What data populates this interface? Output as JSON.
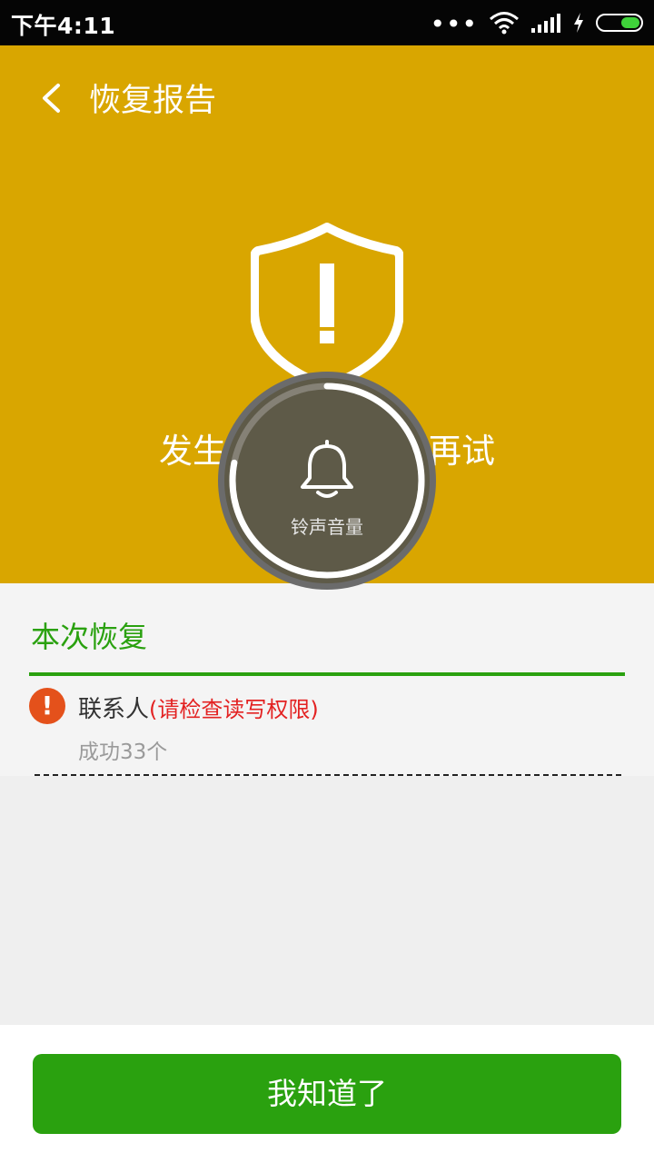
{
  "status_bar": {
    "time": "下午4:11",
    "dots": "•••",
    "battery_level": 0.45,
    "battery_color": "#3fd23a"
  },
  "header": {
    "title": "恢复报告",
    "back_icon": "chevron-left-icon"
  },
  "hero": {
    "background_color": "#d9a600",
    "icon": "shield-exclamation-icon",
    "message": "发生异常，请稍后再试"
  },
  "volume_overlay": {
    "icon": "bell-icon",
    "label": "铃声音量",
    "level": 0.78
  },
  "result_section": {
    "title": "本次恢复",
    "accent_color": "#2aa10f",
    "items": [
      {
        "icon": "exclamation-icon",
        "name": "联系人",
        "warning": "(请检查读写权限)",
        "detail": "成功33个"
      }
    ]
  },
  "footer": {
    "button_label": "我知道了",
    "button_color": "#2aa10f"
  }
}
